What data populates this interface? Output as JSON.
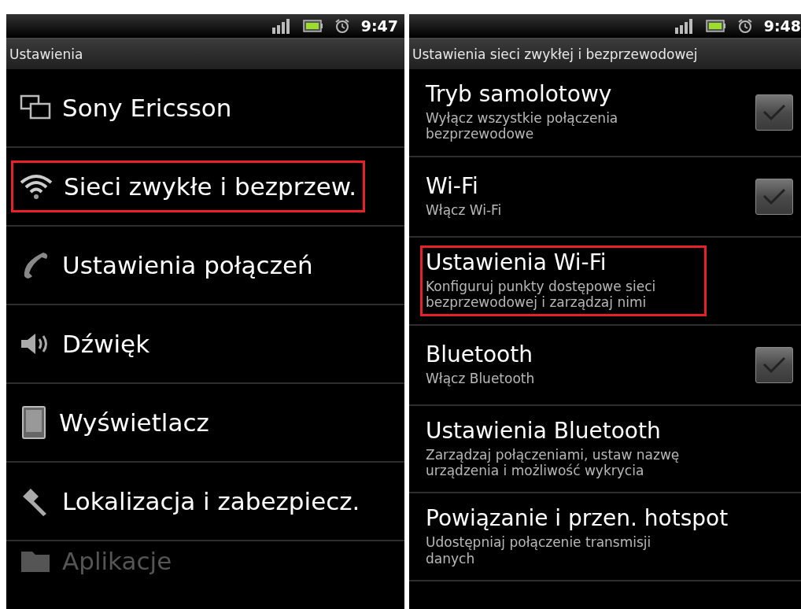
{
  "screens": [
    {
      "status_bar": {
        "time": "9:47"
      },
      "title": "Ustawienia",
      "items": [
        {
          "kind": "icon",
          "label": "Sony Ericsson",
          "highlighted": false,
          "dimmed": false
        },
        {
          "kind": "icon",
          "label": "Sieci zwykłe i bezprzew.",
          "highlighted": true,
          "dimmed": false
        },
        {
          "kind": "icon",
          "label": "Ustawienia połączeń",
          "highlighted": false,
          "dimmed": false
        },
        {
          "kind": "icon",
          "label": "Dźwięk",
          "highlighted": false,
          "dimmed": false
        },
        {
          "kind": "icon",
          "label": "Wyświetlacz",
          "highlighted": false,
          "dimmed": false
        },
        {
          "kind": "icon",
          "label": "Lokalizacja i zabezpiecz.",
          "highlighted": false,
          "dimmed": false
        },
        {
          "kind": "icon",
          "label": "Aplikacje",
          "highlighted": false,
          "dimmed": true
        }
      ]
    },
    {
      "status_bar": {
        "time": "9:48"
      },
      "title": "Ustawienia sieci zwykłej i bezprzewodowej",
      "items": [
        {
          "kind": "checkbox",
          "label": "Tryb samolotowy",
          "summary": "Wyłącz wszystkie połączenia bezprzewodowe",
          "checked": false,
          "highlighted": false
        },
        {
          "kind": "checkbox",
          "label": "Wi-Fi",
          "summary": "Włącz Wi-Fi",
          "checked": false,
          "highlighted": false
        },
        {
          "kind": "link",
          "label": "Ustawienia Wi-Fi",
          "summary": "Konfiguruj punkty dostępowe sieci bezprzewodowej i zarządzaj nimi",
          "highlighted": true
        },
        {
          "kind": "checkbox",
          "label": "Bluetooth",
          "summary": "Włącz Bluetooth",
          "checked": false,
          "highlighted": false
        },
        {
          "kind": "link",
          "label": "Ustawienia Bluetooth",
          "summary": "Zarządzaj połączeniami, ustaw nazwę urządzenia i możliwość wykrycia",
          "highlighted": false
        },
        {
          "kind": "link",
          "label": "Powiązanie i przen. hotspot",
          "summary": "Udostępniaj połączenie transmisji danych",
          "highlighted": false
        }
      ]
    }
  ]
}
